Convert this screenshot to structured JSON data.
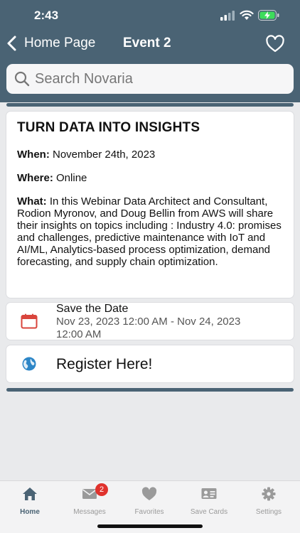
{
  "status_bar": {
    "time": "2:43"
  },
  "nav": {
    "back_label": "Home Page",
    "title": "Event 2"
  },
  "search": {
    "placeholder": "Search Novaria"
  },
  "event": {
    "title": "TURN DATA INTO INSIGHTS",
    "when_label": "When:",
    "when_value": "November 24th, 2023",
    "where_label": "Where:",
    "where_value": "Online",
    "what_label": "What:",
    "what_value": "In this Webinar Data Architect and Consultant, Rodion Myronov, and Doug Bellin from AWS will share their insights on topics including : Industry 4.0: promises and challenges, predictive maintenance with IoT and AI/ML, Analytics-based process optimization, demand forecasting, and supply chain optimization."
  },
  "save_date": {
    "label": "Save the Date",
    "range": "Nov 23, 2023 12:00 AM - Nov 24, 2023 12:00 AM"
  },
  "register": {
    "label": "Register Here!"
  },
  "tabs": [
    {
      "label": "Home",
      "icon": "home-icon",
      "active": true
    },
    {
      "label": "Messages",
      "icon": "envelope-icon",
      "badge": "2"
    },
    {
      "label": "Favorites",
      "icon": "heart-icon"
    },
    {
      "label": "Save Cards",
      "icon": "contact-card-icon"
    },
    {
      "label": "Settings",
      "icon": "gear-icon"
    }
  ],
  "colors": {
    "header": "#4a6374",
    "calendar": "#d9453c",
    "globe": "#2d86c7",
    "badge": "#e0322d"
  }
}
